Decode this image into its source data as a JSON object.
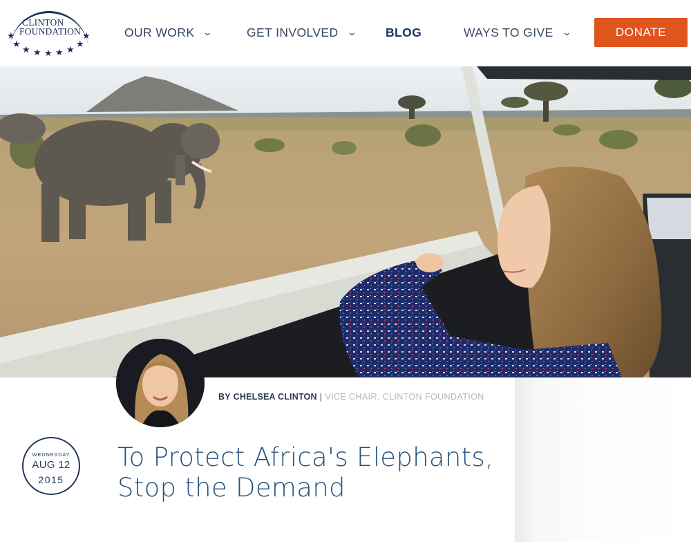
{
  "logo": {
    "line1": "CLINTON",
    "line2": "FOUNDATION",
    "icon": "stars-arc-logo"
  },
  "nav": {
    "items": [
      {
        "label": "OUR WORK",
        "has_dropdown": true,
        "icon": "chevron-down-icon"
      },
      {
        "label": "GET INVOLVED",
        "has_dropdown": true,
        "icon": "chevron-down-icon"
      },
      {
        "label": "BLOG",
        "active": true
      },
      {
        "label": "WAYS TO GIVE",
        "has_dropdown": true,
        "icon": "chevron-down-icon"
      }
    ],
    "chevron": "⌄",
    "donate_label": "DONATE"
  },
  "article": {
    "byline_prefix": "BY",
    "author": "CHELSEA CLINTON",
    "separator": "|",
    "role": "VICE CHAIR, CLINTON FOUNDATION",
    "date": {
      "weekday": "WEDNESDAY",
      "month_day": "AUG 12",
      "year": "2015"
    },
    "title": "To Protect Africa's Elephants, Stop the Demand"
  },
  "colors": {
    "accent": "#e0541e",
    "brand_navy": "#1c2f5a",
    "title_blue": "#24527f"
  }
}
